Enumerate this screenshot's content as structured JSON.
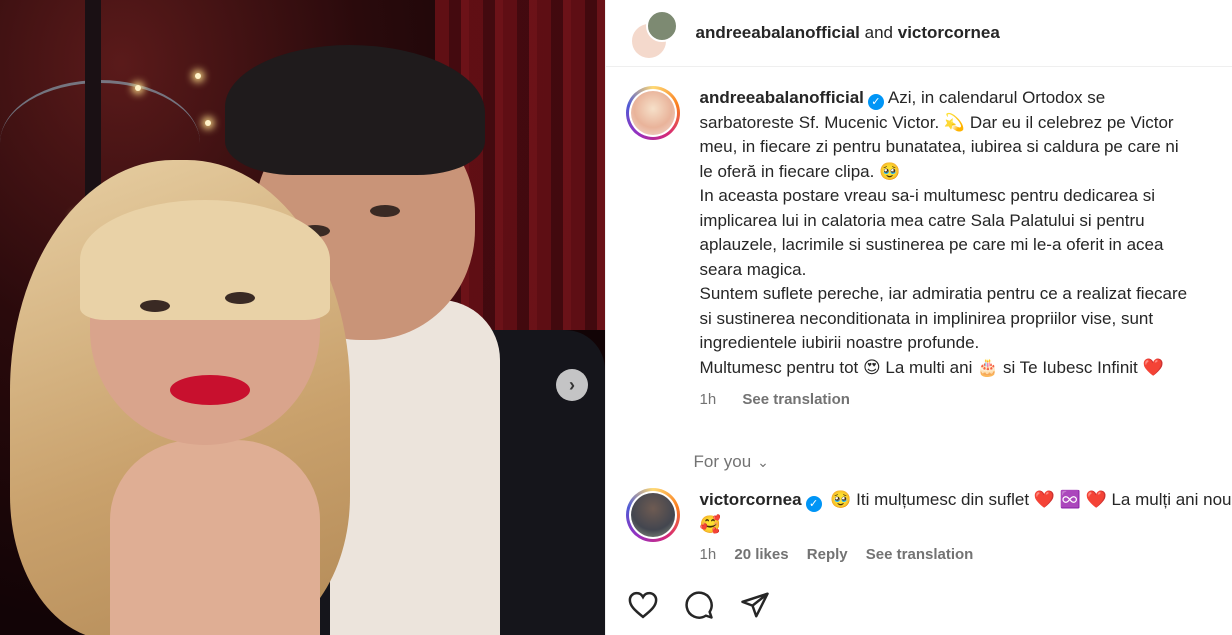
{
  "header": {
    "user_a": "andreeabalanofficial",
    "conj": "and",
    "user_b": "victorcornea"
  },
  "caption": {
    "username": "andreeabalanofficial",
    "lines": [
      "Azi, in calendarul Ortodox se",
      "sarbatoreste Sf. Mucenic Victor. 💫  Dar eu il celebrez pe Victor",
      "meu, in fiecare zi pentru bunatatea, iubirea si caldura pe care ni",
      "le oferă in fiecare clipa. 🥹",
      "In aceasta postare vreau sa-i multumesc pentru dedicarea si",
      "implicarea lui in calatoria mea catre Sala Palatului si pentru",
      "aplauzele, lacrimile si sustinerea pe care mi le-a oferit in acea",
      "seara magica.",
      "Suntem suflete pereche, iar admiratia pentru ce a realizat fiecare",
      "si sustinerea neconditionata in implinirea propriilor vise, sunt",
      "ingredientele iubirii noastre profunde.",
      "Multumesc pentru tot 😍 La multi ani 🎂 si Te Iubesc Infinit ❤️"
    ],
    "time": "1h",
    "see_translation": "See translation"
  },
  "for_you": {
    "label": "For you"
  },
  "reply": {
    "username": "victorcornea",
    "text": "🥹 Iti mulțumesc din suflet ❤️ ♾️ ❤️  La mulți ani nouă 🥰",
    "time": "1h",
    "likes": "20 likes",
    "reply_label": "Reply",
    "see_translation": "See translation"
  },
  "icons": {
    "next": "chevron-right-icon",
    "like": "heart-icon",
    "comment": "comment-icon",
    "share": "share-icon",
    "verified": "verified-badge-icon"
  },
  "colors": {
    "verified": "#0095f6",
    "muted": "#737373",
    "text": "#262626"
  }
}
